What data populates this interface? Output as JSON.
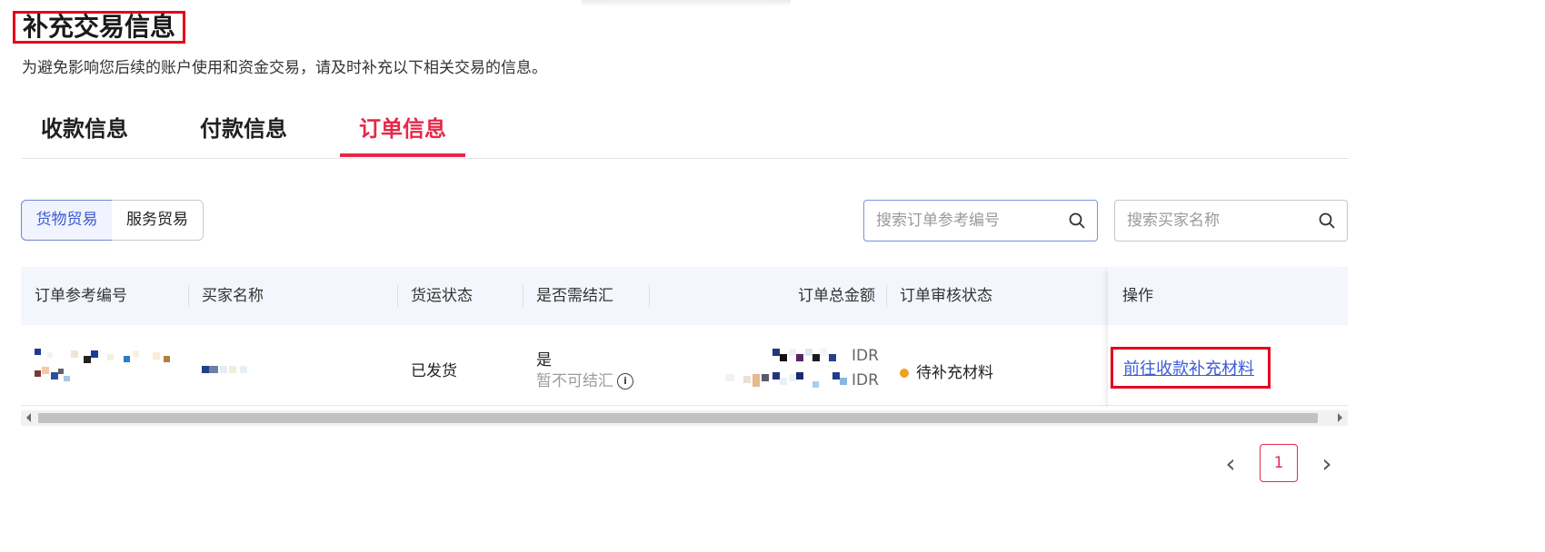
{
  "page": {
    "title": "补充交易信息",
    "subtitle": "为避免影响您后续的账户使用和资金交易，请及时补充以下相关交易的信息。"
  },
  "tabs": [
    {
      "label": "收款信息",
      "active": false
    },
    {
      "label": "付款信息",
      "active": false
    },
    {
      "label": "订单信息",
      "active": true
    }
  ],
  "trade_type": {
    "options": [
      "货物贸易",
      "服务贸易"
    ],
    "selected": "货物贸易"
  },
  "search": {
    "order_ref_placeholder": "搜索订单参考编号",
    "buyer_placeholder": "搜索买家名称"
  },
  "table": {
    "columns": [
      "订单参考编号",
      "买家名称",
      "货运状态",
      "是否需结汇",
      "订单总金额",
      "订单审核状态",
      "操作"
    ],
    "rows": [
      {
        "shipping_status": "已发货",
        "settlement": "是",
        "settlement_note": "暂不可结汇",
        "currency_1": "IDR",
        "currency_2": "IDR",
        "review_status": "待补充材料",
        "action": "前往收款补充材料"
      }
    ]
  },
  "pagination": {
    "current_page": "1",
    "prev_icon": "chevron-left-icon",
    "next_icon": "chevron-right-icon"
  },
  "colors": {
    "accent": "#e5294a",
    "link": "#3b5bd6",
    "status_dot": "#f0a11b",
    "highlight_box": "#e4001c"
  }
}
